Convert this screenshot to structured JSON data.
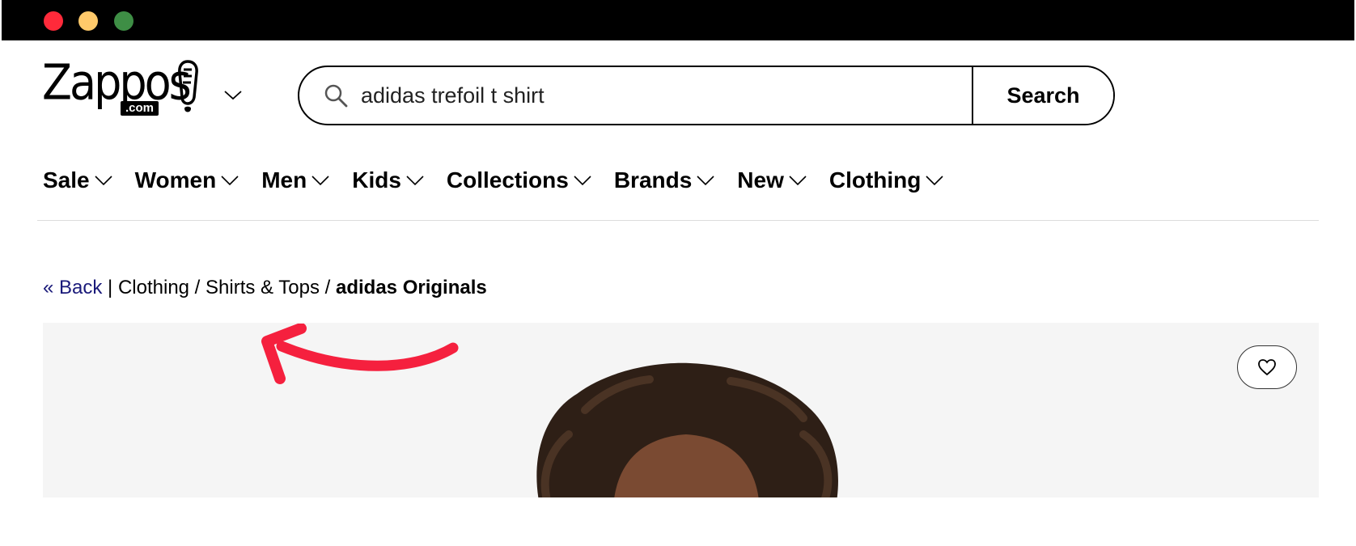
{
  "window": {
    "controls": [
      "close",
      "minimize",
      "maximize"
    ]
  },
  "logo": {
    "text": "Zappos",
    "suffix": ".com",
    "icon": "zappos-shoe-icon"
  },
  "search": {
    "value": "adidas trefoil t shirt",
    "placeholder": "",
    "button_label": "Search",
    "icon": "search-icon"
  },
  "nav": {
    "items": [
      {
        "label": "Sale"
      },
      {
        "label": "Women"
      },
      {
        "label": "Men"
      },
      {
        "label": "Kids"
      },
      {
        "label": "Collections"
      },
      {
        "label": "Brands"
      },
      {
        "label": "New"
      },
      {
        "label": "Clothing"
      }
    ]
  },
  "breadcrumb": {
    "back": "« Back",
    "sep1": " | ",
    "level1": "Clothing",
    "sep2": " / ",
    "level2": "Shirts & Tops",
    "sep3": " / ",
    "current": "adidas Originals"
  },
  "product": {
    "favorite_icon": "heart-icon",
    "annotation_color": "#f5203e"
  }
}
